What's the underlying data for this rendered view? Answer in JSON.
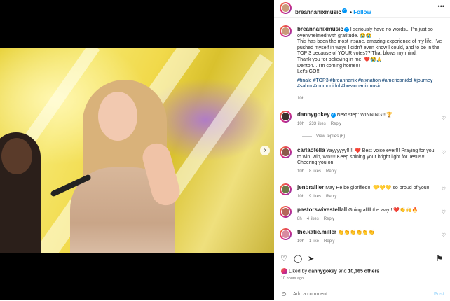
{
  "header": {
    "username": "breannanixmusic",
    "follow_label": "Follow",
    "more_label": "•••"
  },
  "caption": {
    "username": "breannanixmusic",
    "text_lines": [
      "I seriously have no words... I'm just so overwhelmed with gratitude. 😭😭",
      "This has been the most insane, amazing experience of my life. I've pushed myself in ways I didn't even know I could, and to be in the TOP 3 because of YOUR votes?? That blows my mind.",
      "Thank you for believing in me. ❤️😭🙏",
      "Denton... I'm coming home!!!",
      "Let's GO!!!"
    ],
    "hashtags": "#finale #TOP3 #breannanix #nixnation #americanidol #journey #sahm #momonidol #breannanixmusic",
    "time": "10h"
  },
  "comments": [
    {
      "username": "dannygokey",
      "text": "Next step: WINNING!!!🏆",
      "time": "10h",
      "likes": "233 likes",
      "reply": "Reply"
    },
    {
      "username": "carlaofella",
      "text": "Yayyyyyy!!!!! ❤️ Best voice ever!!! Praying for you to win, win, win!!!! Keep shining your bright light for Jesus!!! Cheering you on!",
      "time": "10h",
      "likes": "8 likes",
      "reply": "Reply"
    },
    {
      "username": "jenbrallier",
      "text": "May He be glorified!!! 💛💛💛 so proud of you!!",
      "time": "10h",
      "likes": "9 likes",
      "reply": "Reply"
    },
    {
      "username": "pastorswivestellall",
      "text": "Going alllll the way!! ❤️👏🙌🔥",
      "time": "8h",
      "likes": "4 likes",
      "reply": "Reply"
    },
    {
      "username": "the.katie.miller",
      "text": "👏👏👏👏👏👏",
      "time": "10h",
      "likes": "1 like",
      "reply": "Reply"
    }
  ],
  "view_replies": "View replies (6)",
  "actions": {
    "liked_by_prefix": "Liked by",
    "liked_by_user": "dannygokey",
    "liked_by_and": "and",
    "liked_by_count": "10,365 others",
    "time_ago": "10 hours ago",
    "add_comment_placeholder": "Add a comment...",
    "post_label": "Post"
  },
  "colors": {
    "accent": "#0095f6",
    "muted": "#737373",
    "hashtag": "#00376b"
  }
}
